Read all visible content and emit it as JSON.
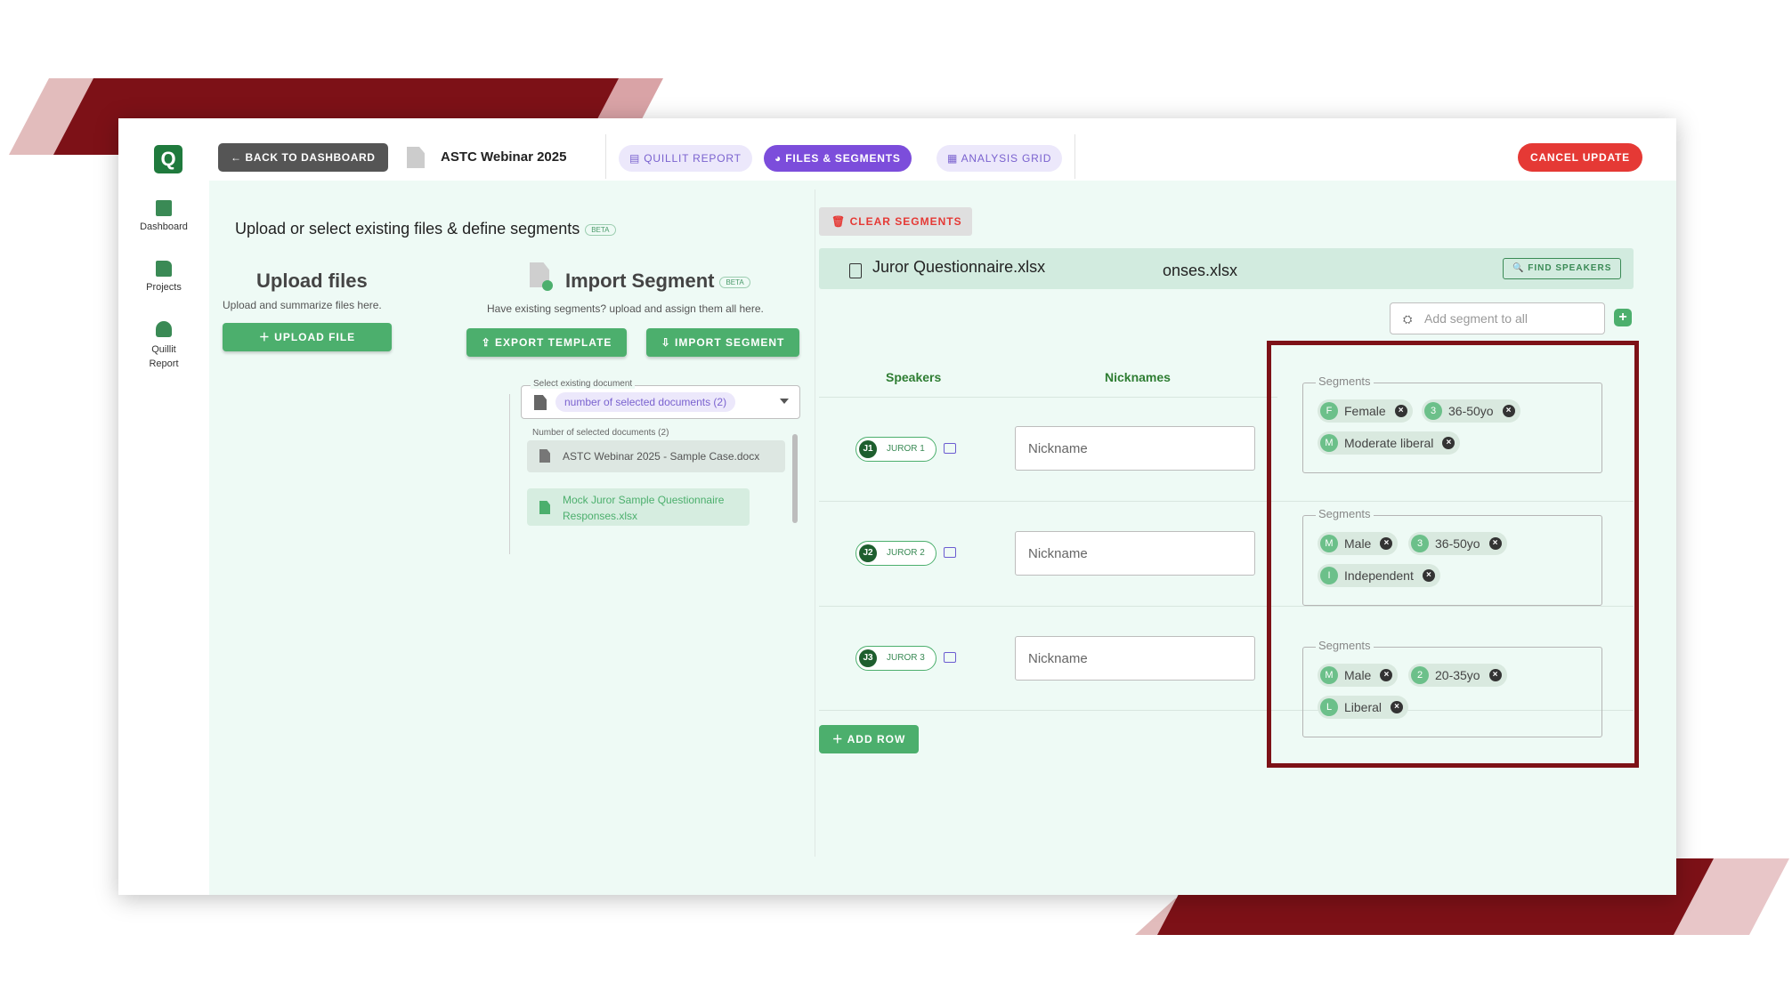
{
  "topbar": {
    "back_label": "BACK TO DASHBOARD",
    "project_title": "ASTC Webinar 2025",
    "tabs": [
      {
        "label": "QUILLIT REPORT"
      },
      {
        "label": "FILES & SEGMENTS"
      },
      {
        "label": "ANALYSIS GRID"
      }
    ],
    "cancel_label": "CANCEL UPDATE"
  },
  "sidebar": {
    "logo": "Q",
    "items": [
      {
        "label": "Dashboard"
      },
      {
        "label": "Projects"
      },
      {
        "label": "Quillit Report"
      }
    ]
  },
  "left_panel": {
    "heading": "Upload or select existing files & define segments",
    "beta": "BETA",
    "upload": {
      "title": "Upload files",
      "subtitle": "Upload and summarize files here.",
      "button": "UPLOAD FILE"
    },
    "import": {
      "title": "Import Segment",
      "beta": "BETA",
      "subtitle": "Have existing segments? upload and assign them all here.",
      "export_button": "EXPORT TEMPLATE",
      "import_button": "IMPORT SEGMENT"
    },
    "select_doc": {
      "label": "Select existing document",
      "value": "number of selected documents (2)",
      "count_label": "Number of selected documents (2)",
      "documents": [
        {
          "name": "ASTC Webinar 2025 - Sample Case.docx"
        },
        {
          "name": "Mock Juror Sample Questionnaire Responses.xlsx"
        }
      ]
    }
  },
  "right_panel": {
    "clear_label": "CLEAR SEGMENTS",
    "file_name": "Juror Questionnaire.xlsx",
    "file_name_tail": "onses.xlsx",
    "find_speakers": "FIND SPEAKERS",
    "add_segment_placeholder": "Add segment to all",
    "columns": {
      "speakers": "Speakers",
      "nicknames": "Nicknames"
    },
    "rows": [
      {
        "avatar": "J1",
        "speaker": "JUROR 1",
        "nickname_placeholder": "Nickname",
        "segments_label": "Segments",
        "segments": [
          {
            "initial": "F",
            "label": "Female"
          },
          {
            "initial": "3",
            "label": "36-50yo"
          },
          {
            "initial": "M",
            "label": "Moderate liberal"
          }
        ]
      },
      {
        "avatar": "J2",
        "speaker": "JUROR 2",
        "nickname_placeholder": "Nickname",
        "segments_label": "Segments",
        "segments": [
          {
            "initial": "M",
            "label": "Male"
          },
          {
            "initial": "3",
            "label": "36-50yo"
          },
          {
            "initial": "I",
            "label": "Independent"
          }
        ]
      },
      {
        "avatar": "J3",
        "speaker": "JUROR 3",
        "nickname_placeholder": "Nickname",
        "segments_label": "Segments",
        "segments": [
          {
            "initial": "M",
            "label": "Male"
          },
          {
            "initial": "2",
            "label": "20-35yo"
          },
          {
            "initial": "L",
            "label": "Liberal"
          }
        ]
      }
    ],
    "add_row": "ADD ROW"
  },
  "colors": {
    "brand_green": "#4caf6d",
    "accent_purple": "#7c4ddb",
    "danger_red": "#e53935",
    "highlight_frame": "#7d1117"
  }
}
